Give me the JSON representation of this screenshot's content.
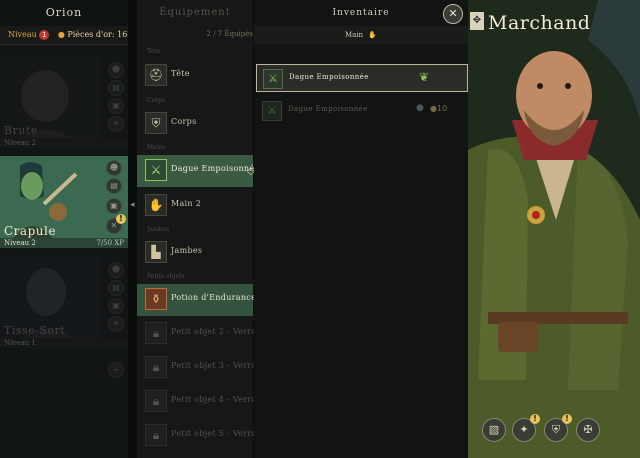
{
  "party": {
    "title": "Orion",
    "level_label": "Niveau",
    "level_badge": "1",
    "gold_label": "Pièces d'or: 16",
    "heroes": [
      {
        "name": "Brute",
        "level": "Niveau 2",
        "xp": ""
      },
      {
        "name": "Crapule",
        "level": "Niveau 2",
        "xp": "7/50 XP"
      },
      {
        "name": "Tisse-Sort",
        "level": "Niveau 1",
        "xp": ""
      }
    ]
  },
  "equipment": {
    "title": "Équipement",
    "count": "2 / 7 Équipés",
    "sections": {
      "head": "Tête",
      "chest": "Corps",
      "hands": "Mains",
      "legs": "Jambes",
      "small": "Petits objets"
    },
    "slots": [
      {
        "label": "Tête",
        "icon": "helmet-icon"
      },
      {
        "label": "Corps",
        "icon": "armor-icon"
      },
      {
        "label": "Dague Empoisonnée",
        "icon": "dagger-icon"
      },
      {
        "label": "Main 2",
        "icon": "hand-icon"
      },
      {
        "label": "Jambes",
        "icon": "boots-icon"
      },
      {
        "label": "Potion d'Endurance",
        "icon": "potion-icon"
      },
      {
        "label": "Petit objet 2 - Verrouillé",
        "icon": "lock-icon"
      },
      {
        "label": "Petit objet 3 - Verrouillé",
        "icon": "lock-icon"
      },
      {
        "label": "Petit objet 4 - Verrouillé",
        "icon": "lock-icon"
      },
      {
        "label": "Petit objet 5 - Verrouillé",
        "icon": "lock-icon"
      }
    ]
  },
  "inventory": {
    "title": "Inventaire",
    "filter": "Main",
    "items": [
      {
        "name": "Dague Empoisonnée",
        "price": ""
      },
      {
        "name": "Dague Empoisonnée",
        "price": "10"
      }
    ]
  },
  "merchant": {
    "title": "Marchand"
  },
  "colors": {
    "accent_green": "#3a5a44",
    "gold": "#e0a23a",
    "badge_red": "#c0392b"
  }
}
